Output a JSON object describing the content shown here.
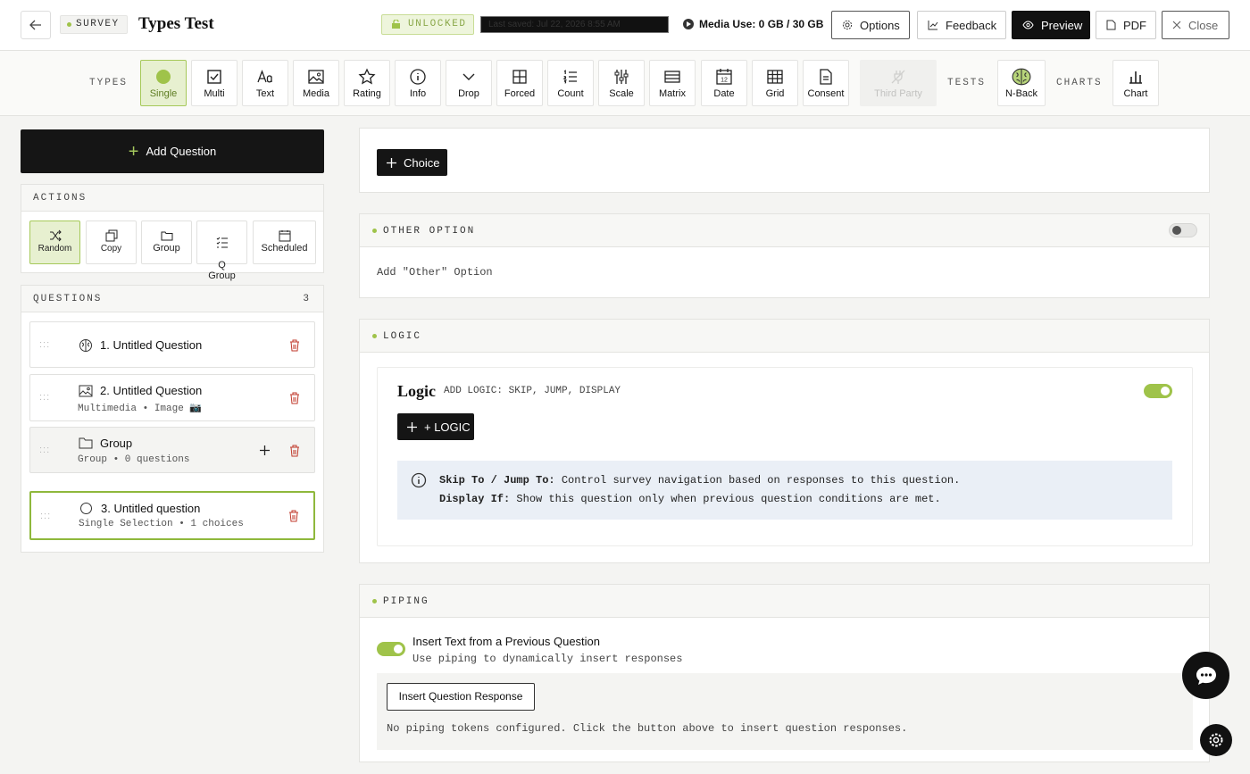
{
  "header": {
    "tag": "SURVEY",
    "title": "Types Test",
    "lock_status": "UNLOCKED",
    "last_saved": "Last saved: Jul 22, 2026 8:55 AM",
    "media_use": "Media Use: 0 GB / 30 GB",
    "buttons": {
      "options": "Options",
      "feedback": "Feedback",
      "preview": "Preview",
      "pdf": "PDF",
      "close": "Close"
    }
  },
  "types_bar": {
    "types_label": "TYPES",
    "tests_label": "TESTS",
    "charts_label": "CHARTS",
    "types": [
      {
        "label": "Single",
        "icon": "single-choice-icon"
      },
      {
        "label": "Multi",
        "icon": "checkbox-icon"
      },
      {
        "label": "Text",
        "icon": "text-icon"
      },
      {
        "label": "Media",
        "icon": "image-icon"
      },
      {
        "label": "Rating",
        "icon": "star-icon"
      },
      {
        "label": "Info",
        "icon": "info-icon"
      },
      {
        "label": "Drop",
        "icon": "chevron-down-icon"
      },
      {
        "label": "Forced",
        "icon": "grid-icon"
      },
      {
        "label": "Count",
        "icon": "numbered-list-icon"
      },
      {
        "label": "Scale",
        "icon": "sliders-icon"
      },
      {
        "label": "Matrix",
        "icon": "table-icon"
      },
      {
        "label": "Date",
        "icon": "calendar-icon"
      },
      {
        "label": "Grid",
        "icon": "grid-table-icon"
      },
      {
        "label": "Consent",
        "icon": "document-icon"
      },
      {
        "label": "Third Party",
        "icon": "plug-icon"
      }
    ],
    "tests": [
      {
        "label": "N-Back",
        "icon": "brain-icon"
      }
    ],
    "charts": [
      {
        "label": "Chart",
        "icon": "bar-chart-icon"
      }
    ]
  },
  "sidebar": {
    "add_question": "Add Question",
    "actions_label": "ACTIONS",
    "actions": [
      {
        "label": "Random",
        "icon": "shuffle-icon"
      },
      {
        "label": "Copy",
        "icon": "copy-icon"
      },
      {
        "label": "Group",
        "icon": "folder-icon"
      },
      {
        "label": "Q\nGroup",
        "icon": "list-check-icon"
      },
      {
        "label": "Scheduled",
        "icon": "calendar-icon"
      }
    ],
    "questions_label": "QUESTIONS",
    "questions_count": "3",
    "questions": [
      {
        "title": "1. Untitled Question",
        "subtitle": "",
        "icon": "brain-icon"
      },
      {
        "title": "2. Untitled Question",
        "subtitle": "Multimedia • Image 📷",
        "icon": "image-icon"
      },
      {
        "title": "Group",
        "subtitle": "Group • 0 questions",
        "icon": "folder-icon"
      },
      {
        "title": "3. Untitled question",
        "subtitle": "Single Selection • 1 choices",
        "icon": "radio-icon"
      }
    ]
  },
  "main": {
    "choice_button": "Choice",
    "other_option": {
      "header": "OTHER OPTION",
      "text": "Add \"Other\" Option",
      "enabled": false
    },
    "logic": {
      "header": "LOGIC",
      "title": "Logic",
      "subtitle": "ADD LOGIC: SKIP, JUMP, DISPLAY",
      "enabled": true,
      "add_button": "+ LOGIC",
      "info_line1_bold": "Skip To / Jump To:",
      "info_line1": "Control survey navigation based on responses to this question.",
      "info_line2_bold": "Display If:",
      "info_line2": "Show this question only when previous question conditions are met."
    },
    "piping": {
      "header": "PIPING",
      "toggle_title": "Insert Text from a Previous Question",
      "toggle_sub": "Use piping to dynamically insert responses",
      "enabled": true,
      "insert_button": "Insert Question Response",
      "empty_text": "No piping tokens configured. Click the button above to insert question responses."
    }
  },
  "colors": {
    "accent": "#9fc34a",
    "dark": "#151515",
    "danger": "#c0392b"
  }
}
